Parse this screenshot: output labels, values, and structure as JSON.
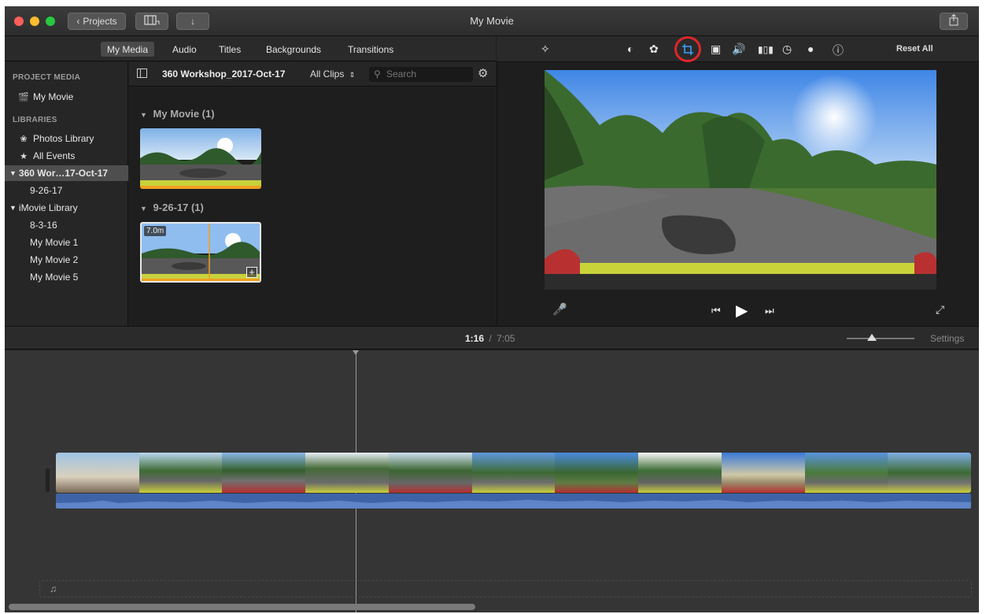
{
  "window": {
    "title": "My Movie",
    "back_button_label": "Projects",
    "colors": {
      "accent": "#f0a020",
      "audio_track": "#3e64a8",
      "crop_highlight": "#e0262a"
    }
  },
  "media_tabs": [
    "My Media",
    "Audio",
    "Titles",
    "Backgrounds",
    "Transitions"
  ],
  "sidebar": {
    "project_media_heading": "PROJECT MEDIA",
    "project_item": "My Movie",
    "libraries_heading": "LIBRARIES",
    "photos_library": "Photos Library",
    "all_events": "All Events",
    "library_360": "360 Wor…17-Oct-17",
    "event_360": "9-26-17",
    "library_imovie": "iMovie Library",
    "events": [
      "8-3-16",
      "My Movie 1",
      "My Movie 2",
      "My Movie 5"
    ]
  },
  "browser": {
    "event_name": "360 Workshop_2017-Oct-17",
    "filter": "All Clips",
    "search_placeholder": "Search",
    "group1_label": "My Movie  (1)",
    "group2_label": "9-26-17  (1)",
    "clip2_duration": "7.0m"
  },
  "viewer_toolbar": {
    "icons": [
      "magic-wand",
      "color-balance",
      "color-correction",
      "crop",
      "stabilization",
      "volume",
      "noise-reduction",
      "speed",
      "clip-filter",
      "info"
    ],
    "reset_label": "Reset All"
  },
  "playback": {
    "current_time": "1:16",
    "separator": "/",
    "total_time": "7:05",
    "settings_label": "Settings",
    "zoom_level": 0.35
  }
}
